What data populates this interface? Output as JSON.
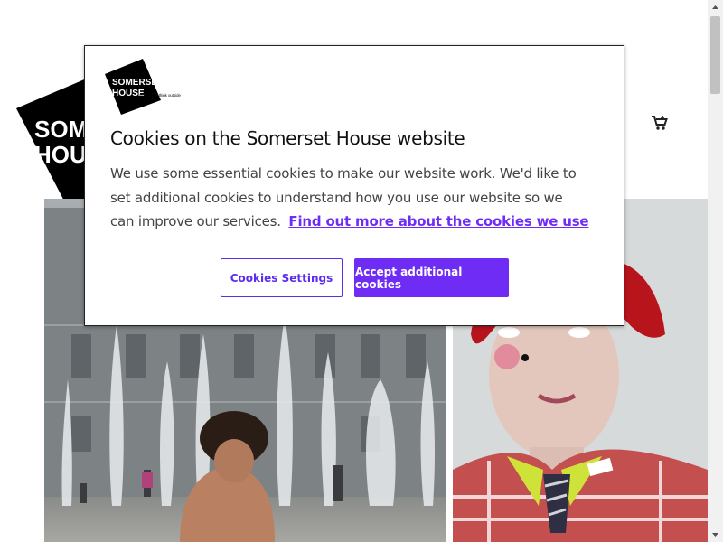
{
  "brand": {
    "logo_line1": "SOMERSET",
    "logo_line2": "HOUSE",
    "tagline": "step inside think outside"
  },
  "header": {
    "cart_icon": "cart-icon"
  },
  "cookie_dialog": {
    "title": "Cookies on the Somerset House website",
    "body": "We use some essential cookies to make our website work. We'd like to set additional cookies to understand how you use our website so we can improve our services.",
    "link_text": "Find out more about the cookies we use",
    "settings_label": "Cookies Settings",
    "accept_label": "Accept additional cookies"
  },
  "colors": {
    "accent": "#6f2cf5",
    "logo_black": "#000000"
  }
}
